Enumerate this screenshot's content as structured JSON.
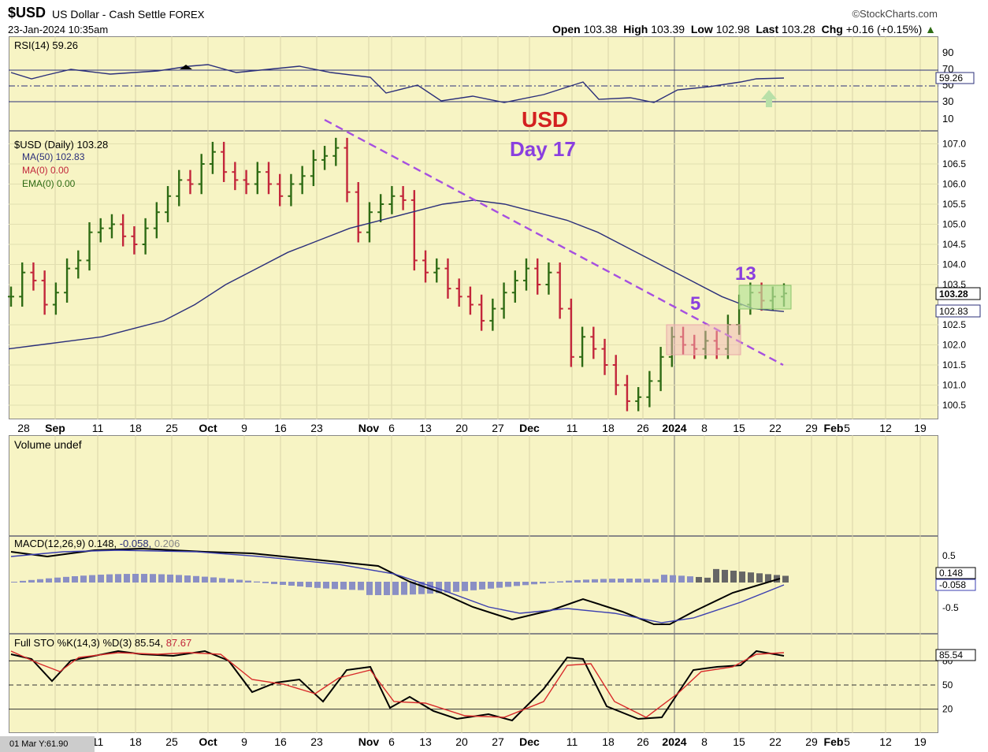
{
  "header": {
    "symbol": "$USD",
    "name": "US Dollar - Cash Settle",
    "exchange": "FOREX",
    "date": "23-Jan-2024 10:35am",
    "logo": "©StockCharts.com",
    "open_label": "Open",
    "open": "103.38",
    "high_label": "High",
    "high": "103.39",
    "low_label": "Low",
    "low": "102.98",
    "last_label": "Last",
    "last": "103.28",
    "chg_label": "Chg",
    "chg": "+0.16 (+0.15%)"
  },
  "rsi": {
    "label": "RSI(14) 59.26",
    "value_tag": "59.26",
    "ticks": [
      "90",
      "70",
      "50",
      "30",
      "10"
    ]
  },
  "price": {
    "legend_main": "$USD (Daily) 103.28",
    "legend_ma50": "MA(50) 102.83",
    "legend_ma0": "MA(0) 0.00",
    "legend_ema0": "EMA(0) 0.00",
    "last_tag": "103.28",
    "ma_tag": "102.83",
    "ticks": [
      "107.0",
      "106.5",
      "106.0",
      "105.5",
      "105.0",
      "104.5",
      "104.0",
      "103.5",
      "102.5",
      "102.0",
      "101.5",
      "101.0",
      "100.5"
    ]
  },
  "annotations": {
    "usd": "USD",
    "day": "Day 17",
    "five": "5",
    "thirteen": "13"
  },
  "dates": [
    "28",
    "Sep",
    "11",
    "18",
    "25",
    "Oct",
    "9",
    "16",
    "23",
    "Nov",
    "6",
    "13",
    "20",
    "27",
    "Dec",
    "11",
    "18",
    "26",
    "2024",
    "8",
    "15",
    "22",
    "29",
    "Feb",
    "5",
    "12",
    "19"
  ],
  "dates2": [
    "11",
    "18",
    "25",
    "Oct",
    "9",
    "16",
    "23",
    "Nov",
    "6",
    "13",
    "20",
    "27",
    "Dec",
    "11",
    "18",
    "26",
    "2024",
    "8",
    "15",
    "22",
    "29",
    "Feb",
    "5",
    "12",
    "19"
  ],
  "volume": {
    "label": "Volume undef"
  },
  "macd": {
    "label": "MACD(12,26,9) 0.148,",
    "sig": "-0.058,",
    "hist": "0.206",
    "tag1": "0.148",
    "tag2": "-0.058",
    "ticks": [
      "0.5",
      "-0.5"
    ]
  },
  "sto": {
    "label": "Full STO %K(14,3) %D(3) 85.54,",
    "d": "87.67",
    "tag": "85.54",
    "ticks": [
      "80",
      "50",
      "20"
    ]
  },
  "footer": {
    "strip": "01 Mar Y:61.90"
  },
  "chart_data": {
    "type": "line",
    "title": "$USD (Daily) 103.28",
    "series": [
      {
        "name": "$USD (Daily)",
        "values": [
          103.2,
          103.8,
          103.6,
          103.0,
          103.3,
          103.9,
          104.1,
          104.8,
          104.9,
          105.0,
          104.7,
          104.5,
          104.9,
          105.3,
          105.7,
          106.1,
          106.0,
          106.5,
          106.8,
          106.3,
          106.1,
          106.0,
          106.3,
          106.0,
          105.7,
          106.0,
          106.2,
          106.6,
          106.7,
          106.9,
          105.8,
          104.8,
          105.3,
          105.5,
          105.7,
          105.6,
          104.1,
          103.8,
          103.9,
          103.4,
          103.2,
          103.0,
          102.6,
          102.9,
          103.3,
          103.6,
          103.9,
          103.5,
          103.8,
          102.9,
          101.7,
          102.2,
          101.9,
          101.5,
          101.0,
          100.6,
          100.7,
          101.1,
          101.7,
          102.2,
          102.0,
          101.9,
          102.1,
          101.9,
          102.5,
          103.0,
          103.3,
          103.1,
          103.2,
          103.28
        ]
      },
      {
        "name": "MA(50)",
        "values": [
          101.9,
          102.0,
          102.1,
          102.2,
          102.4,
          102.6,
          103.0,
          103.5,
          103.9,
          104.3,
          104.6,
          104.9,
          105.1,
          105.3,
          105.5,
          105.6,
          105.5,
          105.3,
          105.1,
          104.8,
          104.4,
          104.0,
          103.6,
          103.2,
          102.9,
          102.83
        ]
      }
    ],
    "ylim": [
      100.3,
      107.2
    ],
    "rsi_value": 59.26,
    "macd": {
      "macd": 0.148,
      "signal": -0.058,
      "histogram": 0.206
    },
    "stochastic": {
      "k": 85.54,
      "d": 87.67
    }
  },
  "colors": {
    "panel_bg": "#f7f4c4",
    "up": "#2e6b14",
    "down": "#c2263b",
    "ma": "#2b2f7a",
    "trend": "#a64fe0",
    "usd": "#d32020",
    "day": "#8a3fdf"
  }
}
